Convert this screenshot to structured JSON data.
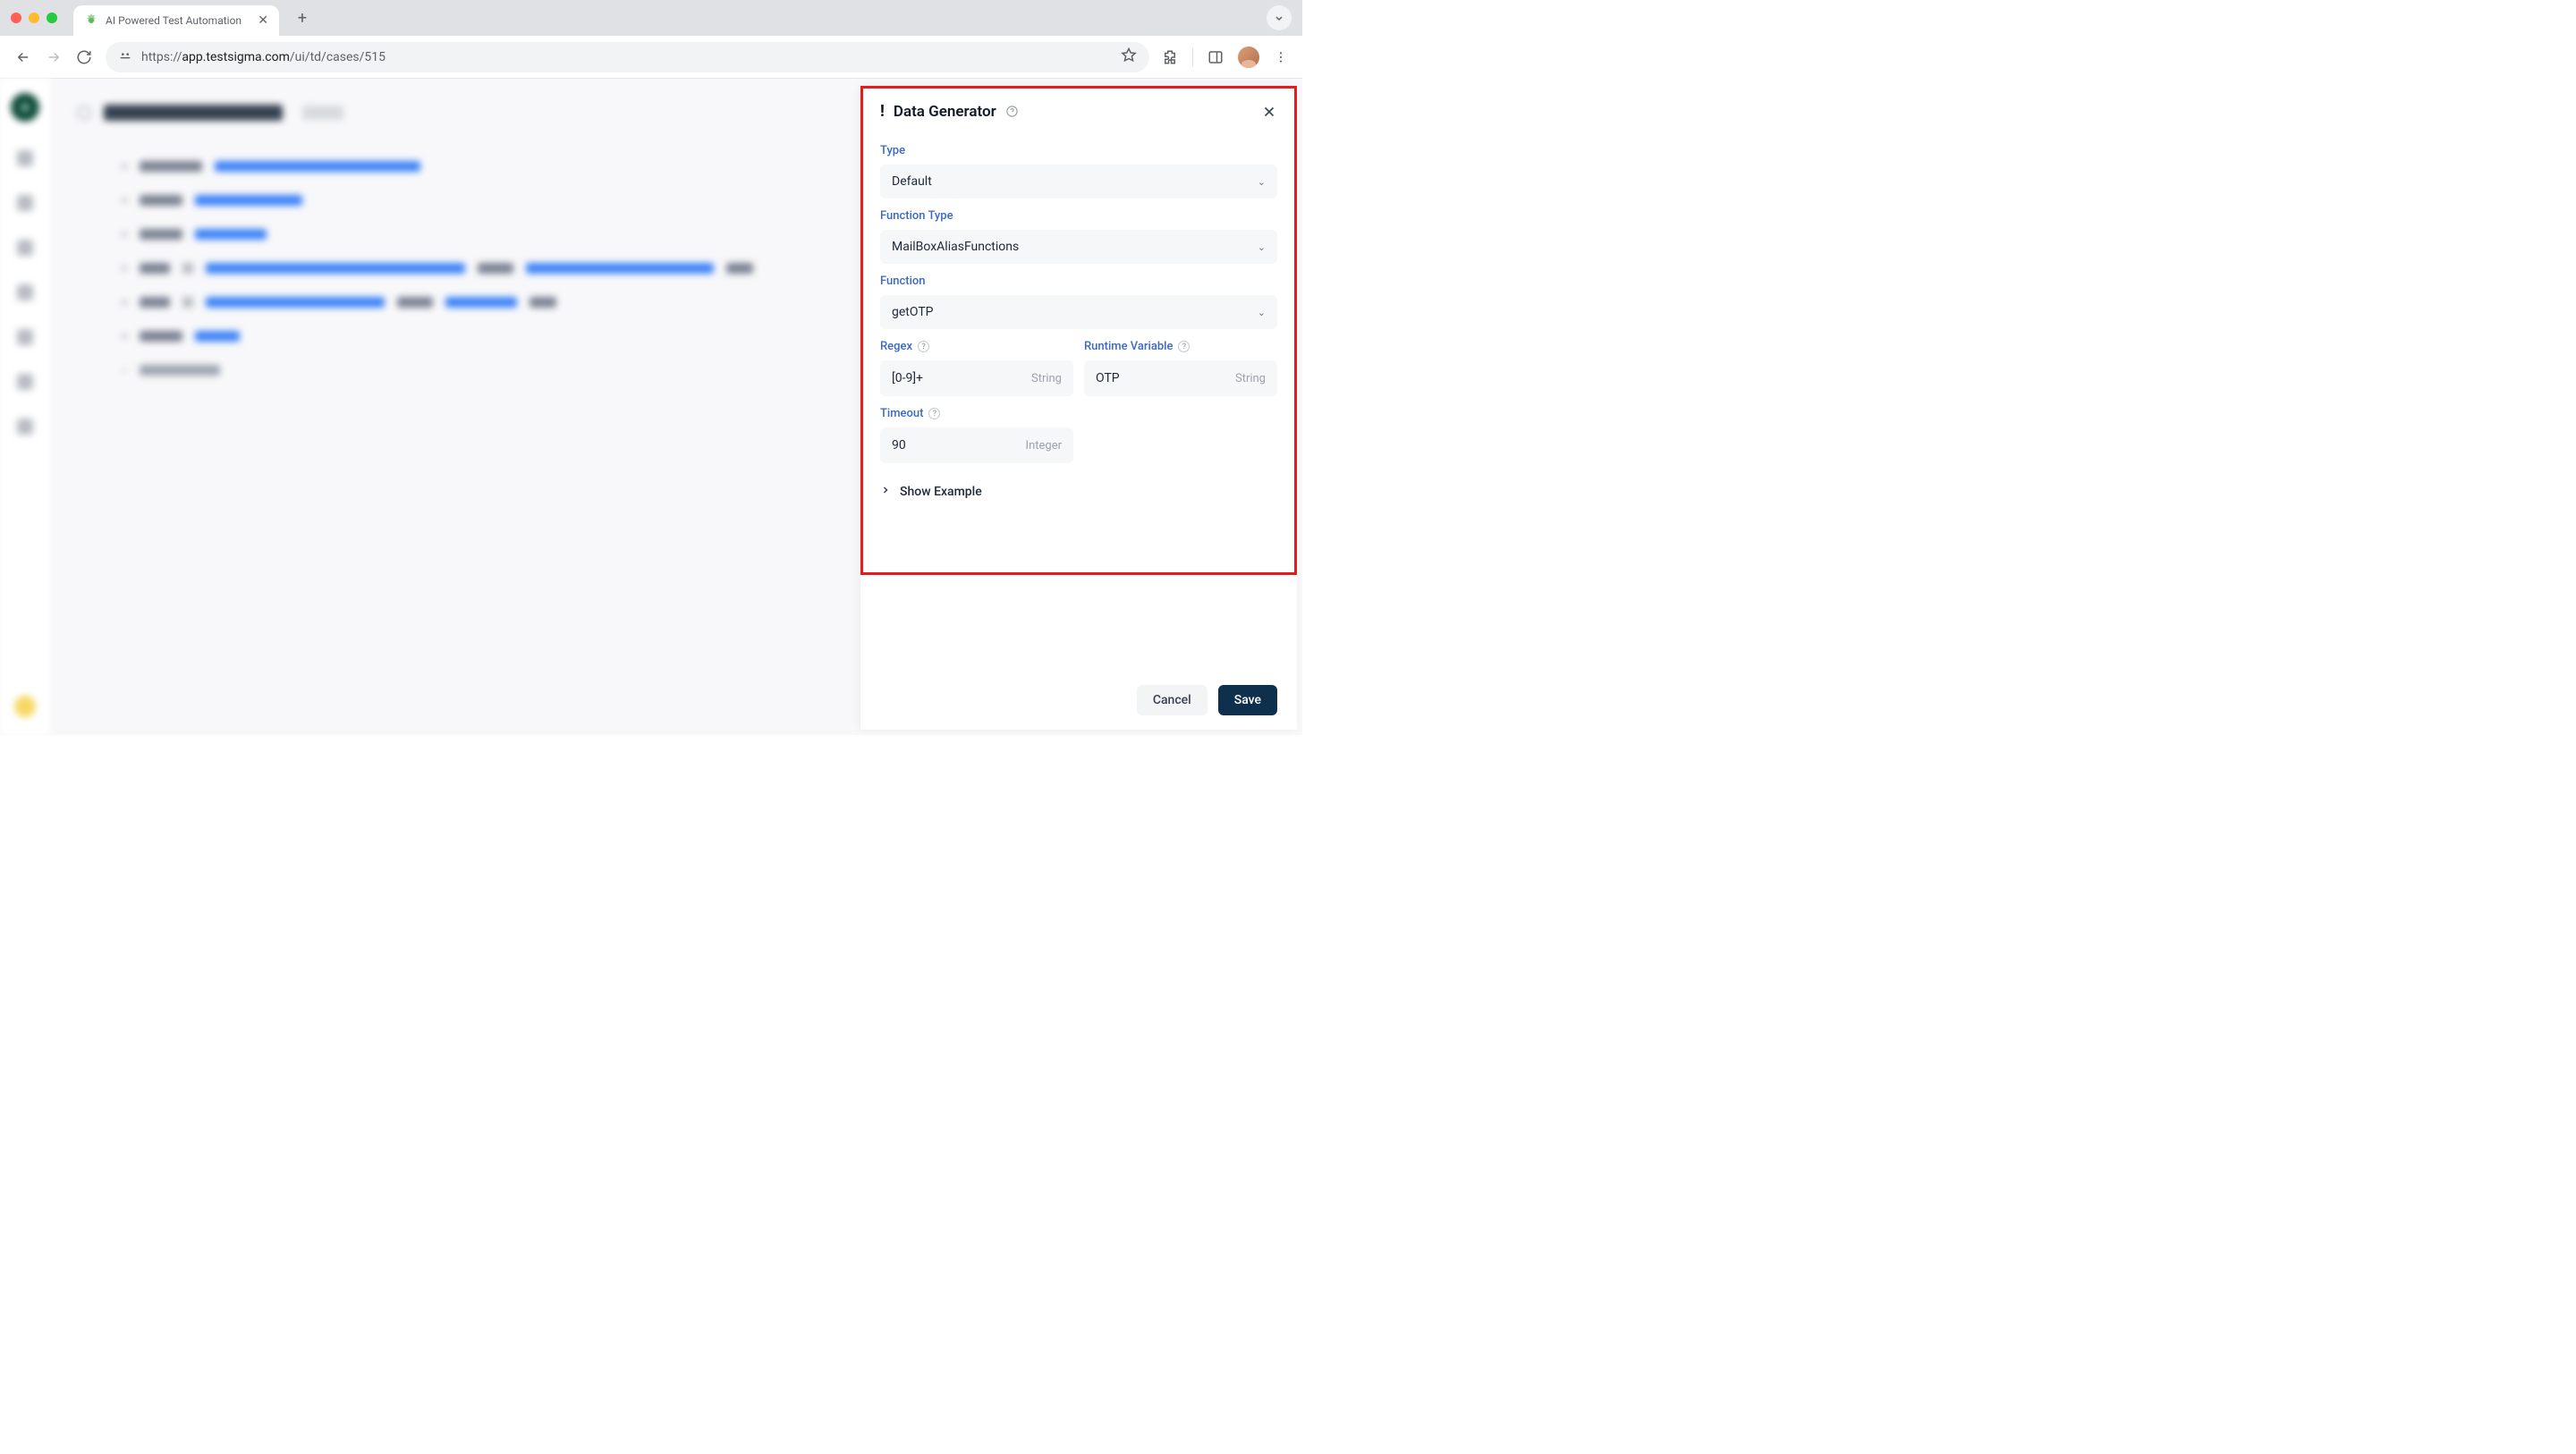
{
  "browser": {
    "tab_title": "AI Powered Test Automation ",
    "url_proto": "https://",
    "url_host": "app.testsigma.com",
    "url_path": "/ui/td/cases/515"
  },
  "panel": {
    "title": "Data Generator",
    "labels": {
      "type": "Type",
      "function_type": "Function Type",
      "function": "Function",
      "regex": "Regex",
      "runtime_variable": "Runtime Variable",
      "timeout": "Timeout"
    },
    "values": {
      "type": "Default",
      "function_type": "MailBoxAliasFunctions",
      "function": "getOTP",
      "regex": "[0-9]+",
      "runtime_variable": "OTP",
      "timeout": "90"
    },
    "suffixes": {
      "string": "String",
      "integer": "Integer"
    },
    "show_example": "Show Example",
    "cancel": "Cancel",
    "save": "Save"
  }
}
